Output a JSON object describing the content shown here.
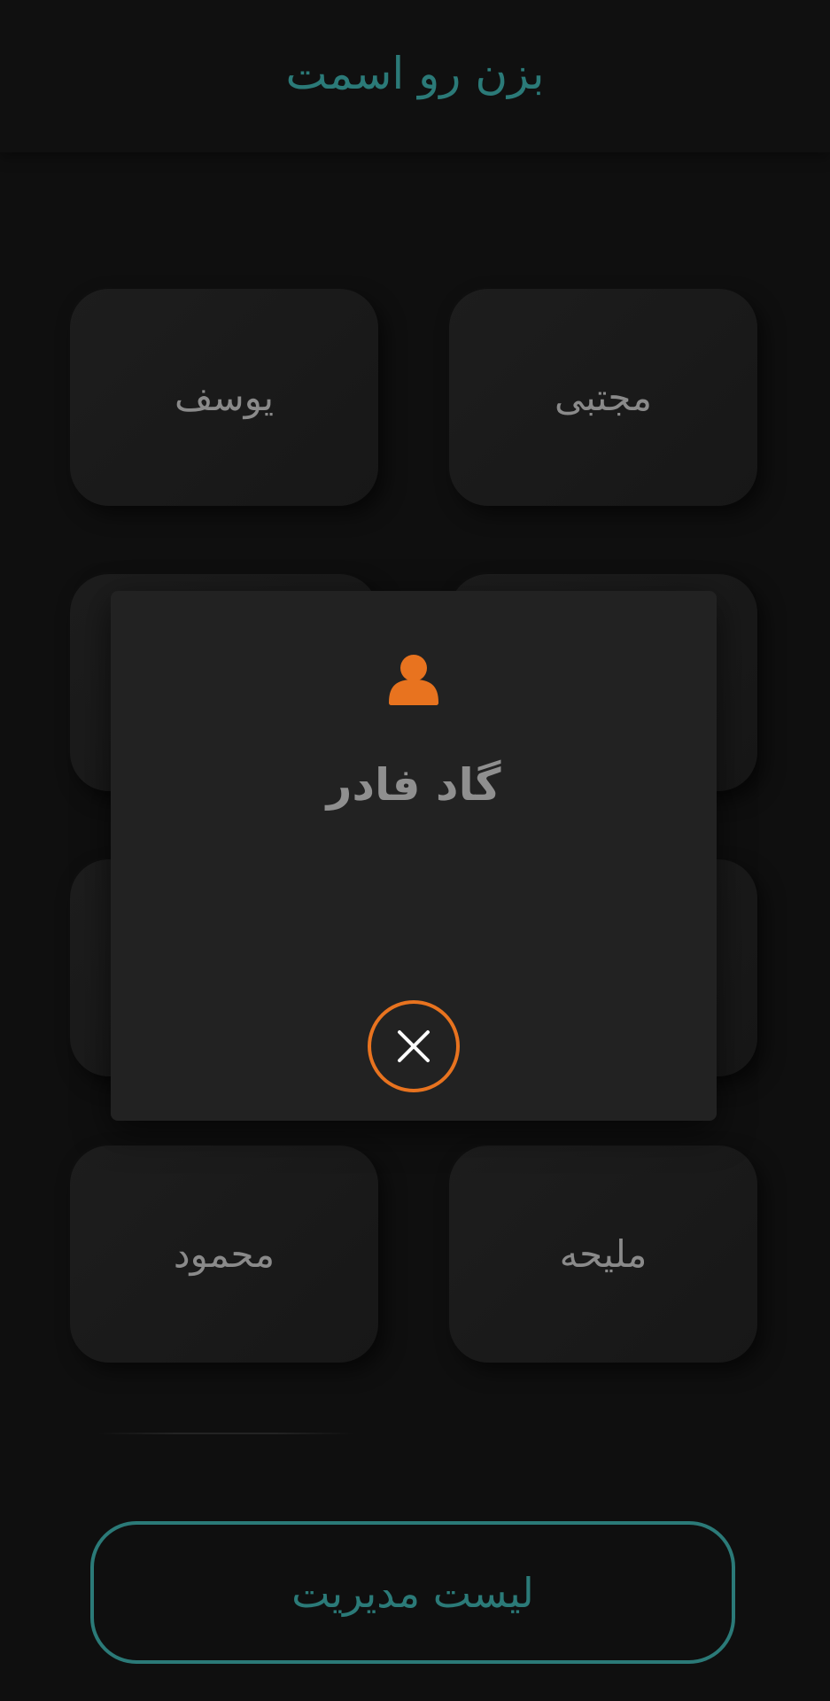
{
  "header": {
    "title": "بزن رو اسمت"
  },
  "names": [
    {
      "label": "مجتبی"
    },
    {
      "label": "یوسف"
    },
    {
      "label": ""
    },
    {
      "label": ""
    },
    {
      "label": ""
    },
    {
      "label": ""
    },
    {
      "label": "ملیحه"
    },
    {
      "label": "محمود"
    }
  ],
  "dialog": {
    "icon": "person-icon",
    "name": "گاد فادر",
    "close_icon": "close-icon"
  },
  "footer": {
    "manage_label": "لیست مدیریت"
  },
  "colors": {
    "accent_teal": "#2b7a78",
    "accent_orange": "#e8731f",
    "background": "#0f0f0f"
  }
}
